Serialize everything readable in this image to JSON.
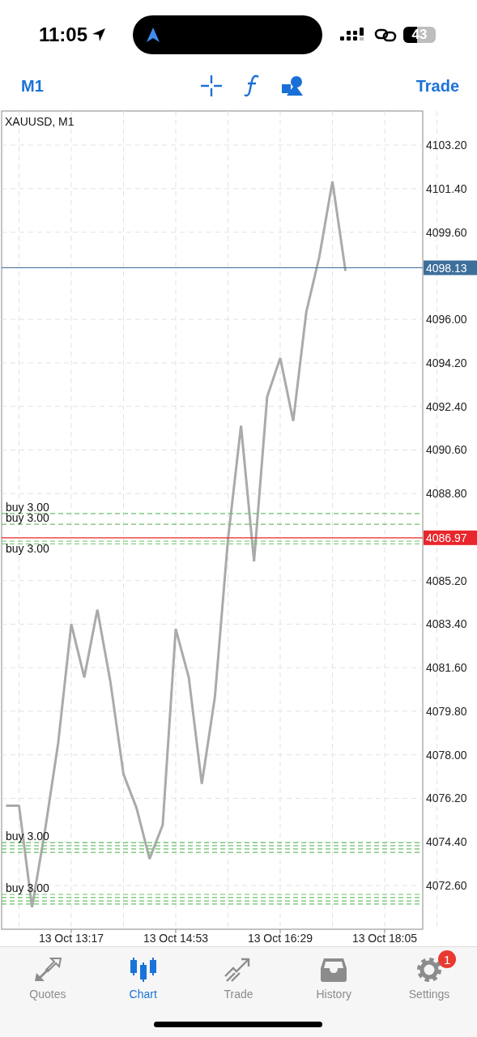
{
  "status_bar": {
    "time": "11:05",
    "battery": "43"
  },
  "toolbar": {
    "period": "M1",
    "action": "Trade"
  },
  "chart": {
    "symbol": "XAUUSD, M1",
    "chart_data": {
      "type": "line",
      "categories": [
        null,
        null,
        null,
        null,
        null,
        "13 Oct 13:17",
        null,
        null,
        null,
        null,
        null,
        null,
        null,
        "13 Oct 14:53",
        null,
        null,
        null,
        null,
        null,
        null,
        null,
        "13 Oct 16:29",
        null,
        null,
        null,
        null,
        null,
        null,
        null,
        "13 Oct 18:05"
      ],
      "series": [
        {
          "color": "#aaaaaa",
          "values": [
            4075.9,
            4075.9,
            4071.7,
            4074.9,
            4078.5,
            4083.4,
            4081.2,
            4084.0,
            4081.0,
            4077.2,
            4075.8,
            4073.7,
            4075.1,
            4083.2,
            4081.2,
            4076.8,
            4080.4,
            4086.9,
            4091.6,
            4086.0,
            4092.8,
            4094.4,
            4091.8,
            4096.3,
            4098.6,
            4101.7,
            4098.0,
            null,
            null,
            null
          ]
        }
      ],
      "ylim": [
        4070.79,
        4104.61
      ],
      "grid": true,
      "ref_lines": [
        {
          "axis": "y",
          "value": 4087.97,
          "color": "#6cbf6c",
          "label": "buy 3.00"
        },
        {
          "axis": "y",
          "value": 4087.53,
          "color": "#6cbf6c",
          "label": "buy 3.00"
        },
        {
          "axis": "y",
          "value": 4086.83,
          "color": "#6cbf6c",
          "label": "buy 3.00"
        },
        {
          "axis": "y",
          "value": 4086.72,
          "color": "#6cbf6c"
        },
        {
          "axis": "y",
          "value": 4074.37,
          "color": "#6cbf6c",
          "label": "buy 3.00"
        },
        {
          "axis": "y",
          "value": 4074.24,
          "color": "#6cbf6c"
        },
        {
          "axis": "y",
          "value": 4074.11,
          "color": "#6cbf6c"
        },
        {
          "axis": "y",
          "value": 4073.97,
          "color": "#6cbf6c"
        },
        {
          "axis": "y",
          "value": 4072.23,
          "color": "#6cbf6c",
          "label": "buy 3.00"
        },
        {
          "axis": "y",
          "value": 4072.1,
          "color": "#6cbf6c"
        },
        {
          "axis": "y",
          "value": 4071.96,
          "color": "#6cbf6c"
        },
        {
          "axis": "y",
          "value": 4071.83,
          "color": "#6cbf6c"
        },
        {
          "axis": "y",
          "value": 4098.13,
          "color": "#3d6f9b",
          "label": "4098.13"
        },
        {
          "axis": "y",
          "value": 4086.97,
          "color": "#e8262b",
          "label": "4086.97"
        }
      ],
      "yticks": [
        {
          "value": 4103.2,
          "label": "4103.20"
        },
        {
          "value": 4101.4,
          "label": "4101.40"
        },
        {
          "value": 4099.6,
          "label": "4099.60"
        },
        {
          "value": 4096.0,
          "label": "4096.00"
        },
        {
          "value": 4094.2,
          "label": "4094.20"
        },
        {
          "value": 4092.4,
          "label": "4092.40"
        },
        {
          "value": 4090.6,
          "label": "4090.60"
        },
        {
          "value": 4088.8,
          "label": "4088.80"
        },
        {
          "value": 4085.2,
          "label": "4085.20"
        },
        {
          "value": 4083.4,
          "label": "4083.40"
        },
        {
          "value": 4081.6,
          "label": "4081.60"
        },
        {
          "value": 4079.8,
          "label": "4079.80"
        },
        {
          "value": 4078.0,
          "label": "4078.00"
        },
        {
          "value": 4076.2,
          "label": "4076.20"
        },
        {
          "value": 4074.4,
          "label": "4074.40"
        },
        {
          "value": 4072.6,
          "label": "4072.60"
        }
      ]
    }
  },
  "tabs": [
    {
      "kind": "quotes",
      "label": "Quotes",
      "selected": false
    },
    {
      "kind": "chart",
      "label": "Chart",
      "selected": true
    },
    {
      "kind": "trade",
      "label": "Trade",
      "selected": false
    },
    {
      "kind": "history",
      "label": "History",
      "selected": false
    },
    {
      "kind": "settings",
      "label": "Settings",
      "selected": false,
      "badge": "1"
    }
  ]
}
